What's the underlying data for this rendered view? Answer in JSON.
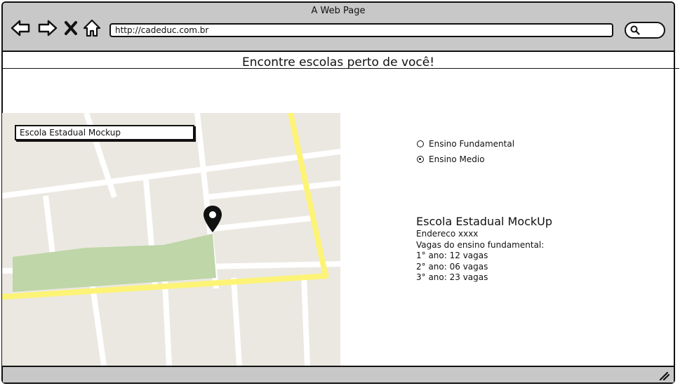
{
  "window": {
    "title": "A Web Page"
  },
  "toolbar": {
    "url": "http://cadeduc.com.br",
    "icons": [
      "back-arrow-icon",
      "forward-arrow-icon",
      "close-x-icon",
      "home-icon",
      "search-icon"
    ]
  },
  "page": {
    "headline": "Encontre escolas perto de você!"
  },
  "map": {
    "search_value": "Escola Estadual Mockup",
    "pin_icon": "map-pin-icon",
    "colors": {
      "land": "#ebe8e1",
      "street": "#ffffff",
      "main_road": "#fdf477",
      "park": "#bfd6a8"
    }
  },
  "filters": {
    "options": [
      {
        "label": "Ensino Fundamental",
        "selected": false
      },
      {
        "label": "Ensino Medio",
        "selected": true
      }
    ]
  },
  "school": {
    "name": "Escola Estadual MockUp",
    "address": "Endereco xxxx",
    "vacancies_title": "Vagas do ensino fundamental:",
    "grades": [
      "1° ano: 12 vagas",
      "2° ano: 06 vagas",
      "3° ano: 23 vagas"
    ]
  }
}
